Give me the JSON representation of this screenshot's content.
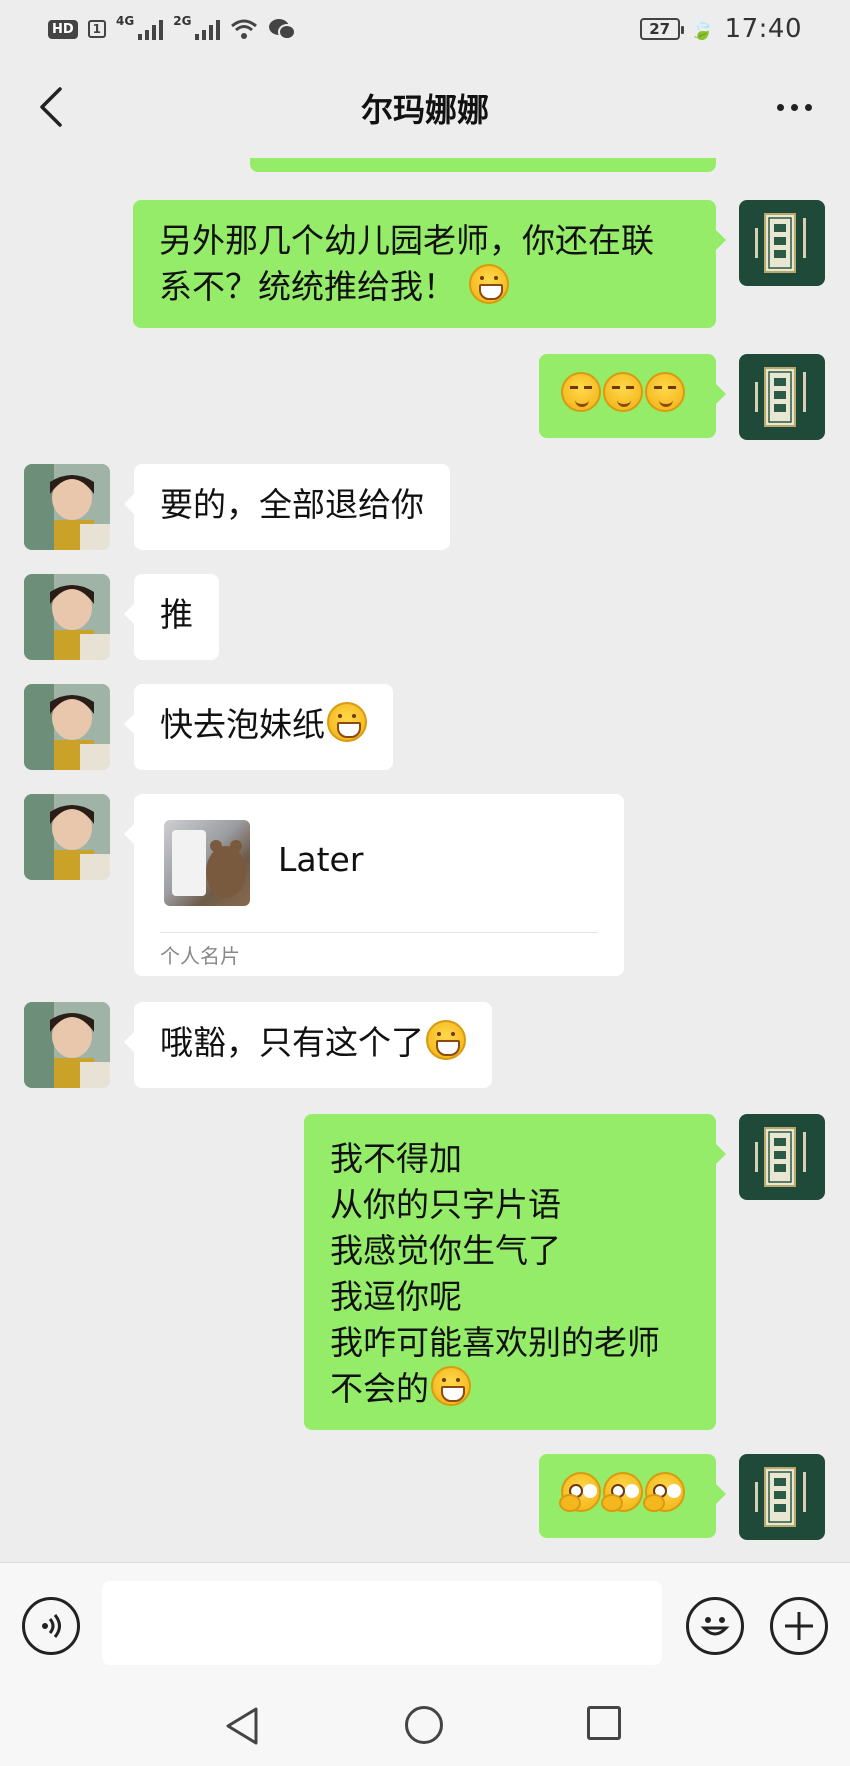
{
  "status_bar": {
    "hd": "HD",
    "sim": "1",
    "net1": "4G",
    "net2": "2G",
    "battery": "27",
    "time": "17:40"
  },
  "header": {
    "title": "尔玛娜娜",
    "back_icon": "chevron-left-icon",
    "more_icon": "more-dots-icon"
  },
  "messages": [
    {
      "side": "out",
      "lines": [
        "另外那几个幼儿园老师，你还在联",
        "系不？统统推给我！"
      ],
      "emoji": "grin"
    },
    {
      "side": "out",
      "lines": [
        ""
      ],
      "emoji": "sly x3"
    },
    {
      "side": "in",
      "lines": [
        "要的，全部退给你"
      ]
    },
    {
      "side": "in",
      "lines": [
        "推"
      ]
    },
    {
      "side": "in",
      "lines": [
        "快去泡妹纸"
      ],
      "emoji": "grin"
    },
    {
      "side": "in",
      "type": "contact-card",
      "card_name": "Later",
      "card_label": "个人名片"
    },
    {
      "side": "in",
      "lines": [
        "哦豁，只有这个了"
      ],
      "emoji": "grin"
    },
    {
      "side": "out",
      "lines": [
        "我不得加",
        "从你的只字片语",
        "我感觉你生气了",
        "我逗你呢",
        "我咋可能喜欢别的老师",
        "不会的"
      ],
      "emoji": "grin"
    },
    {
      "side": "out",
      "lines": [
        ""
      ],
      "emoji": "smirk x3"
    }
  ],
  "input_bar": {
    "voice_icon": "voice-icon",
    "text_value": "",
    "emoji_icon": "emoji-icon",
    "plus_icon": "plus-icon"
  },
  "system_nav": {
    "back_icon": "triangle-back-icon",
    "home_icon": "circle-home-icon",
    "recent_icon": "square-recent-icon"
  },
  "colors": {
    "background": "#ededed",
    "outgoing_bubble": "#95ec69",
    "incoming_bubble": "#ffffff",
    "self_avatar": "#1f4a3a"
  }
}
